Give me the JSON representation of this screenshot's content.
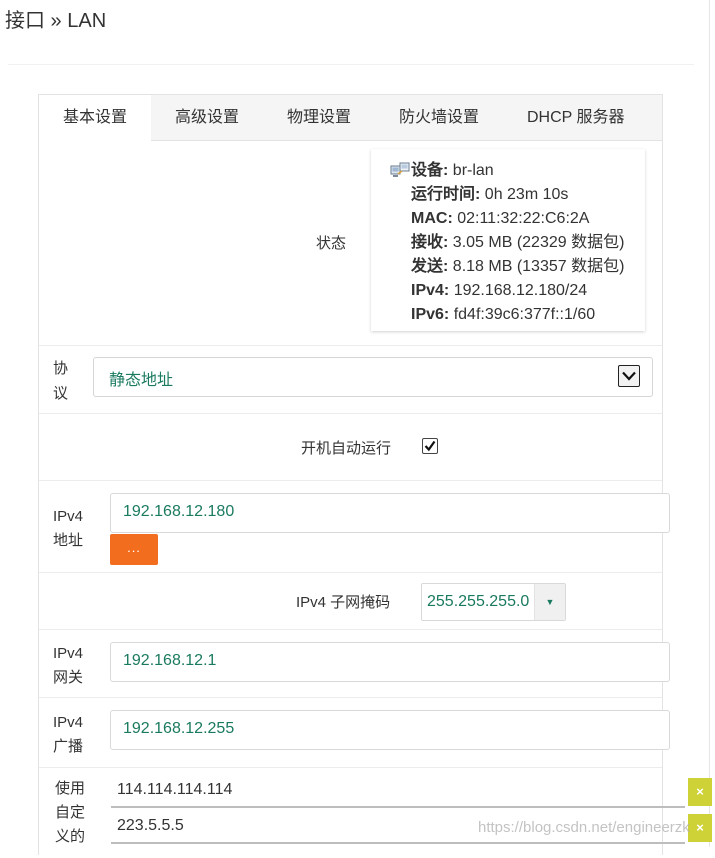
{
  "breadcrumb": "接口 » LAN",
  "tabs": [
    {
      "label": "基本设置",
      "active": true
    },
    {
      "label": "高级设置",
      "active": false
    },
    {
      "label": "物理设置",
      "active": false
    },
    {
      "label": "防火墙设置",
      "active": false
    },
    {
      "label": "DHCP 服务器",
      "active": false
    }
  ],
  "status": {
    "label": "状态",
    "device": {
      "key": "设备:",
      "value": " br-lan"
    },
    "uptime": {
      "key": "运行时间:",
      "value": " 0h 23m 10s"
    },
    "mac": {
      "key": "MAC:",
      "value": " 02:11:32:22:C6:2A"
    },
    "rx": {
      "key": "接收:",
      "value": " 3.05 MB (22329 数据包)"
    },
    "tx": {
      "key": "发送:",
      "value": " 8.18 MB (13357 数据包)"
    },
    "ipv4": {
      "key": "IPv4:",
      "value": " 192.168.12.180/24"
    },
    "ipv6": {
      "key": "IPv6:",
      "value": " fd4f:39c6:377f::1/60"
    }
  },
  "protocol": {
    "label_1": "协",
    "label_2": "议",
    "value": "静态地址"
  },
  "autostart": {
    "label": "开机自动运行",
    "checked": true
  },
  "ipv4_addr": {
    "label_1": "IPv4",
    "label_2": "地址",
    "value": "192.168.12.180",
    "button": "..."
  },
  "netmask": {
    "label": "IPv4 子网掩码",
    "value": "255.255.255.0",
    "arrow": "▼"
  },
  "gateway": {
    "label_1": "IPv4",
    "label_2": "网关",
    "value": "192.168.12.1"
  },
  "broadcast": {
    "label_1": "IPv4",
    "label_2": "广播",
    "value": "192.168.12.255"
  },
  "dns": {
    "label_1": "使用",
    "label_2": "自定",
    "label_3": "义的",
    "servers": [
      "114.114.114.114",
      "223.5.5.5"
    ],
    "remove_label": "×"
  },
  "watermark": "https://blog.csdn.net/engineerzk"
}
